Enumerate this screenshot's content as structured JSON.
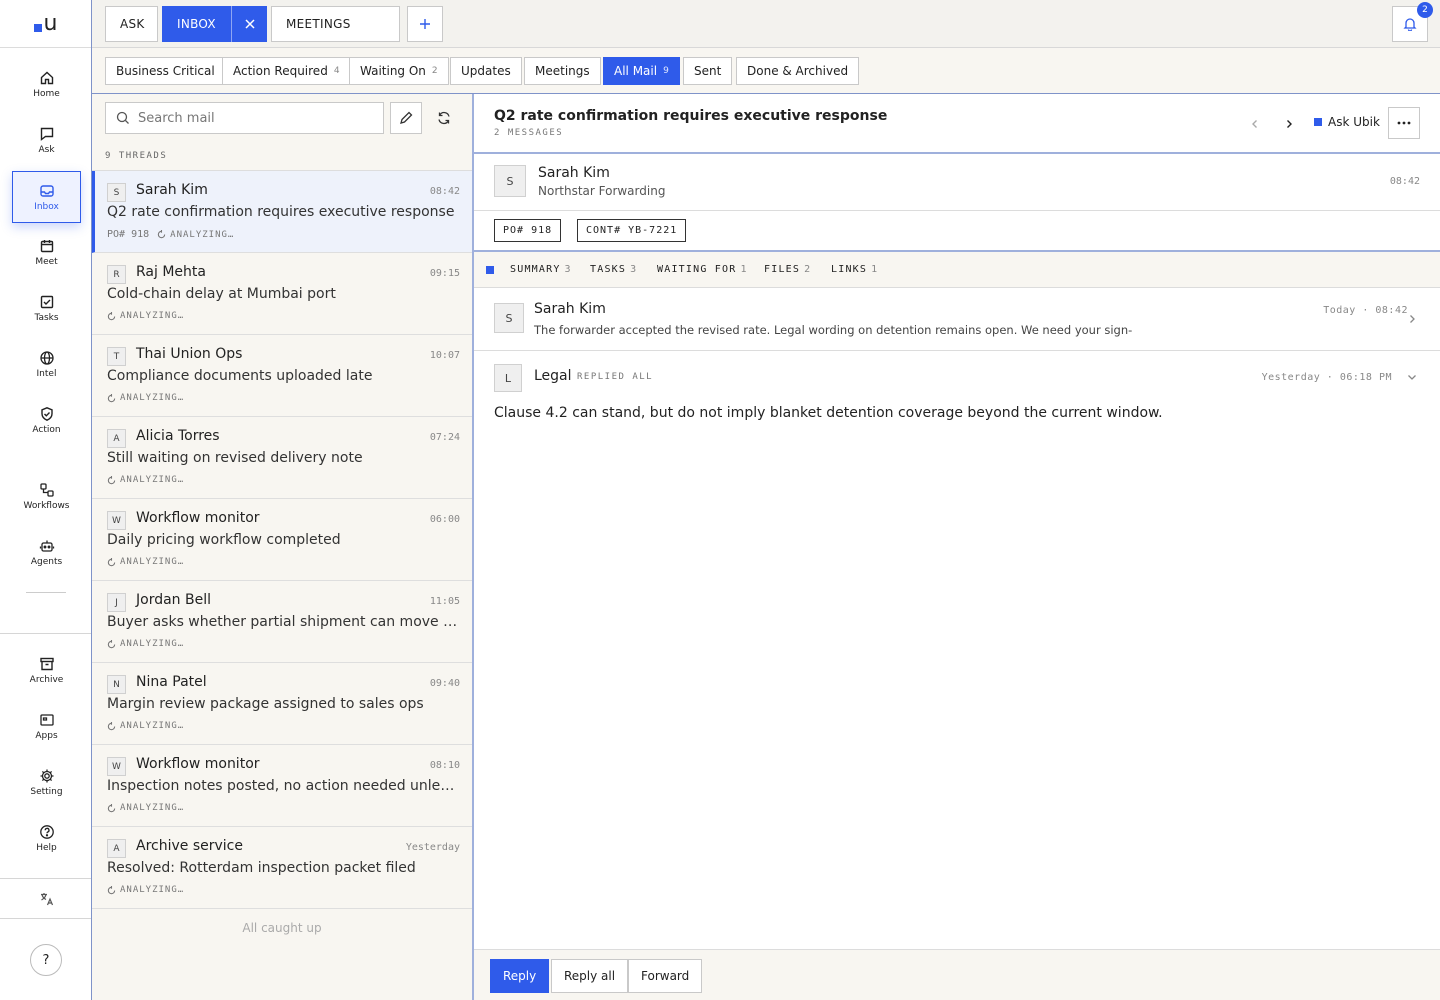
{
  "rail": {
    "brand": "u",
    "items": [
      {
        "label": "Home",
        "icon": "home-icon"
      },
      {
        "label": "Ask",
        "icon": "chat-icon"
      },
      {
        "label": "Inbox",
        "icon": "inbox-icon"
      },
      {
        "label": "Meet",
        "icon": "calendar-icon"
      },
      {
        "label": "Tasks",
        "icon": "checkbox-icon"
      },
      {
        "label": "Intel",
        "icon": "globe-icon"
      },
      {
        "label": "Action",
        "icon": "shield-check-icon"
      },
      {
        "label": "Workflows",
        "icon": "workflow-icon"
      },
      {
        "label": "Agents",
        "icon": "robot-icon"
      },
      {
        "label": "Archive",
        "icon": "archive-icon"
      },
      {
        "label": "Apps",
        "icon": "apps-icon"
      },
      {
        "label": "Setting",
        "icon": "gear-icon"
      },
      {
        "label": "Help",
        "icon": "help-icon"
      }
    ],
    "active": "Inbox",
    "help_glyph": "?"
  },
  "tabs": [
    {
      "label": "ASK"
    },
    {
      "label": "INBOX"
    },
    {
      "label": "MEETINGS"
    }
  ],
  "notifications": {
    "count": "2"
  },
  "filters": [
    {
      "label": "Business Critical",
      "count": ""
    },
    {
      "label": "Action Required",
      "count": "4"
    },
    {
      "label": "Waiting On",
      "count": "2"
    },
    {
      "label": "Updates",
      "count": ""
    },
    {
      "label": "Meetings",
      "count": ""
    },
    {
      "label": "All Mail",
      "count": "9"
    },
    {
      "label": "Sent",
      "count": ""
    },
    {
      "label": "Done & Archived",
      "count": ""
    }
  ],
  "list": {
    "search_placeholder": "Search mail",
    "thread_count": "9 THREADS",
    "caught_up": "All caught up",
    "threads": [
      {
        "initial": "S",
        "sender": "Sarah Kim",
        "time": "08:42",
        "subject": "Q2 rate confirmation requires executive response",
        "po": "PO# 918",
        "status": "ANALYZING…"
      },
      {
        "initial": "R",
        "sender": "Raj Mehta",
        "time": "09:15",
        "subject": "Cold-chain delay at Mumbai port",
        "po": "",
        "status": "ANALYZING…"
      },
      {
        "initial": "T",
        "sender": "Thai Union Ops",
        "time": "10:07",
        "subject": "Compliance documents uploaded late",
        "po": "",
        "status": "ANALYZING…"
      },
      {
        "initial": "A",
        "sender": "Alicia Torres",
        "time": "07:24",
        "subject": "Still waiting on revised delivery note",
        "po": "",
        "status": "ANALYZING…"
      },
      {
        "initial": "W",
        "sender": "Workflow monitor",
        "time": "06:00",
        "subject": "Daily pricing workflow completed",
        "po": "",
        "status": "ANALYZING…"
      },
      {
        "initial": "J",
        "sender": "Jordan Bell",
        "time": "11:05",
        "subject": "Buyer asks whether partial shipment can move first",
        "po": "",
        "status": "ANALYZING…"
      },
      {
        "initial": "N",
        "sender": "Nina Patel",
        "time": "09:40",
        "subject": "Margin review package assigned to sales ops",
        "po": "",
        "status": "ANALYZING…"
      },
      {
        "initial": "W",
        "sender": "Workflow monitor",
        "time": "08:10",
        "subject": "Inspection notes posted, no action needed unless customs flags it",
        "po": "",
        "status": "ANALYZING…"
      },
      {
        "initial": "A",
        "sender": "Archive service",
        "time": "Yesterday",
        "subject": "Resolved: Rotterdam inspection packet filed",
        "po": "",
        "status": "ANALYZING…"
      }
    ]
  },
  "reader": {
    "title": "Q2 rate confirmation requires executive response",
    "message_count": "2 MESSAGES",
    "ask_label": "Ask Ubik",
    "from": {
      "initial": "S",
      "name": "Sarah Kim",
      "org": "Northstar Forwarding",
      "time": "08:42"
    },
    "refs": [
      "PO# 918",
      "CONT# YB-7221"
    ],
    "sections": [
      {
        "label": "SUMMARY",
        "count": "3"
      },
      {
        "label": "TASKS",
        "count": "3"
      },
      {
        "label": "WAITING FOR",
        "count": "1"
      },
      {
        "label": "FILES",
        "count": "2"
      },
      {
        "label": "LINKS",
        "count": "1"
      }
    ],
    "messages": [
      {
        "initial": "S",
        "sender": "Sarah Kim",
        "time": "Today · 08:42",
        "preview": "The forwarder accepted the revised rate. Legal wording on detention remains open. We need your sign-"
      },
      {
        "initial": "L",
        "sender": "Legal",
        "tag": "REPLIED ALL",
        "time": "Yesterday · 06:18 PM",
        "body": "Clause 4.2 can stand, but do not imply blanket detention coverage beyond the current window."
      }
    ],
    "actions": {
      "reply": "Reply",
      "reply_all": "Reply all",
      "forward": "Forward"
    }
  },
  "colors": {
    "accent": "#2f5bea",
    "panel": "#f8f6f1",
    "topbar": "#f3f2ee"
  }
}
